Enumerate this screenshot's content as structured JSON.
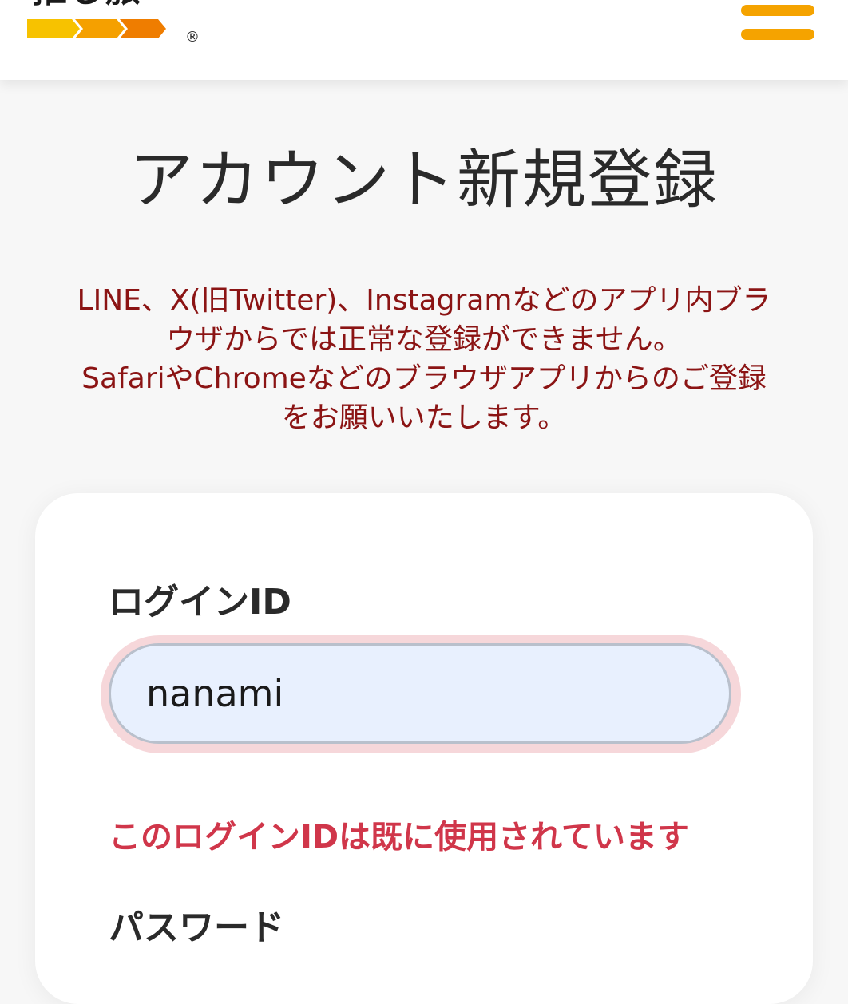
{
  "header": {
    "logo_text": "推し旅",
    "logo_reg_mark": "®",
    "logo_colors": [
      "#f7c200",
      "#f5a000",
      "#ef7d00"
    ],
    "menu_icon": "hamburger-menu-icon",
    "menu_color": "#f5a300"
  },
  "page": {
    "title": "アカウント新規登録",
    "notice_lines": [
      "LINE、X(旧Twitter)、Instagramなどのアプリ内ブラ",
      "ウザからでは正常な登録ができません。",
      "SafariやChromeなどのブラウザアプリからのご登録",
      "をお願いいたします。"
    ]
  },
  "form": {
    "login_id_label": "ログインID",
    "login_id_value": "nanami",
    "login_id_error": "このログインIDは既に使用されています",
    "password_label": "パスワード"
  },
  "colors": {
    "notice": "#8b1414",
    "error": "#d0364a",
    "input_bg": "#e8f0fe",
    "input_error_glow": "#f6d7da"
  }
}
